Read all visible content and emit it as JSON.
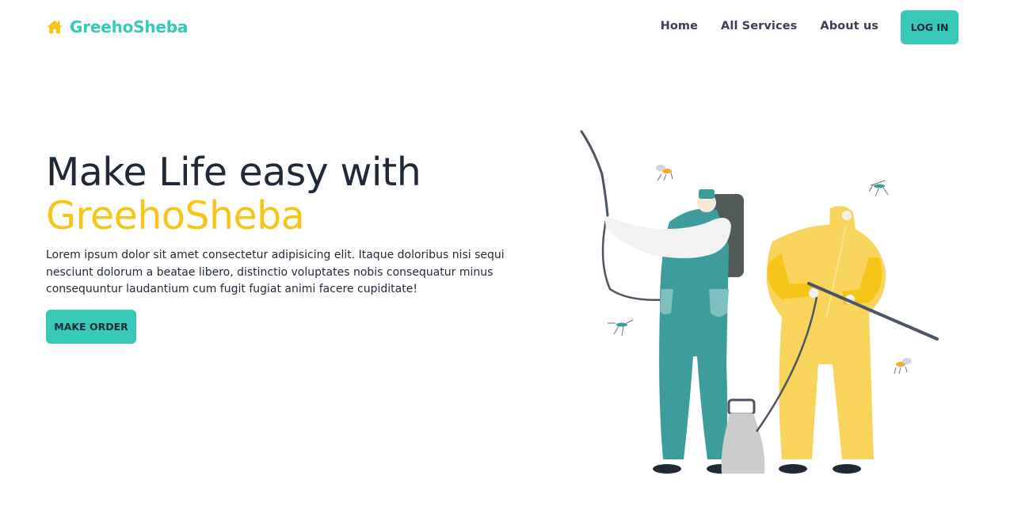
{
  "brand": {
    "name": "GreehoSheba",
    "icon": "home-icon"
  },
  "nav": {
    "links": [
      {
        "label": "Home"
      },
      {
        "label": "All Services"
      },
      {
        "label": "About us"
      }
    ],
    "login_label": "LOG IN"
  },
  "hero": {
    "title_line1": "Make Life easy with",
    "title_accent": "GreehoSheba",
    "description": "Lorem ipsum dolor sit amet consectetur adipisicing elit. Itaque doloribus nisi sequi nesciunt dolorum a beatae libero, distinctio voluptates nobis consequatur minus consequuntur laudantium cum fugit fugiat animi facere cupiditate!",
    "order_label": "MAKE ORDER"
  },
  "colors": {
    "accent": "#36c9b8",
    "highlight": "#f5c518",
    "text": "#1f2937"
  }
}
